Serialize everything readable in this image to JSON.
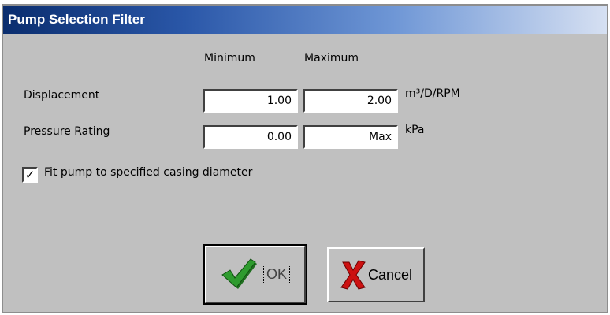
{
  "dialog": {
    "title": "Pump Selection Filter"
  },
  "columns": {
    "minimum": "Minimum",
    "maximum": "Maximum"
  },
  "rows": [
    {
      "label": "Displacement",
      "min": "1.00",
      "max": "2.00",
      "unit": "m³/D/RPM"
    },
    {
      "label": "Pressure Rating",
      "min": "0.00",
      "max": "Max",
      "unit": "kPa"
    }
  ],
  "checkbox": {
    "label": "Fit pump to specified casing diameter",
    "checked": true,
    "mark": "✓"
  },
  "buttons": {
    "ok_label": "OK",
    "cancel_label": "Cancel"
  },
  "colors": {
    "title_start": "#0a2d6e",
    "title_end": "#d6e0f2",
    "dialog_bg": "#c0c0c0",
    "ok_check": "#2e8b2e",
    "cancel_x": "#cc1111"
  },
  "icons": [
    "green-checkmark-icon",
    "red-x-icon"
  ]
}
